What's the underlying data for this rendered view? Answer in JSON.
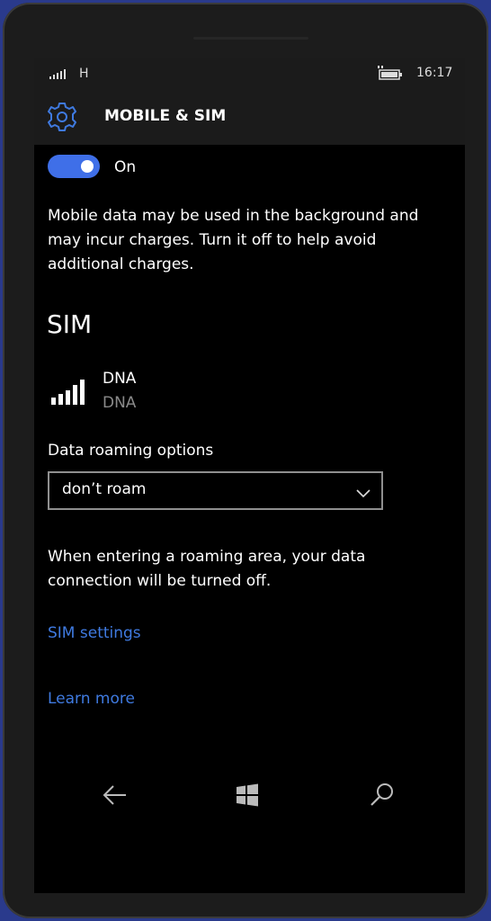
{
  "status_bar": {
    "network_type": "H",
    "time": "16:17"
  },
  "header": {
    "icon": "gear-icon",
    "title": "MOBILE & SIM"
  },
  "mobile_data": {
    "toggle_state": "On",
    "description_lines": [
      "Mobile data may be used in the background and",
      "may incur charges. Turn it off to help avoid",
      "additional charges."
    ]
  },
  "sim": {
    "section_title": "SIM",
    "operator_name": "DNA",
    "operator_subtitle": "DNA"
  },
  "roaming": {
    "label": "Data roaming options",
    "selected": "don’t roam",
    "description_lines": [
      "When entering a roaming area, your data",
      "connection will be turned off."
    ]
  },
  "links": {
    "sim_settings": "SIM settings",
    "learn_more": "Learn more"
  },
  "nav": {
    "back": "back-arrow-icon",
    "start": "windows-logo-icon",
    "search": "search-icon"
  },
  "colors": {
    "accent": "#3f6fe8",
    "link": "#3f7ae0",
    "background": "#000000"
  }
}
